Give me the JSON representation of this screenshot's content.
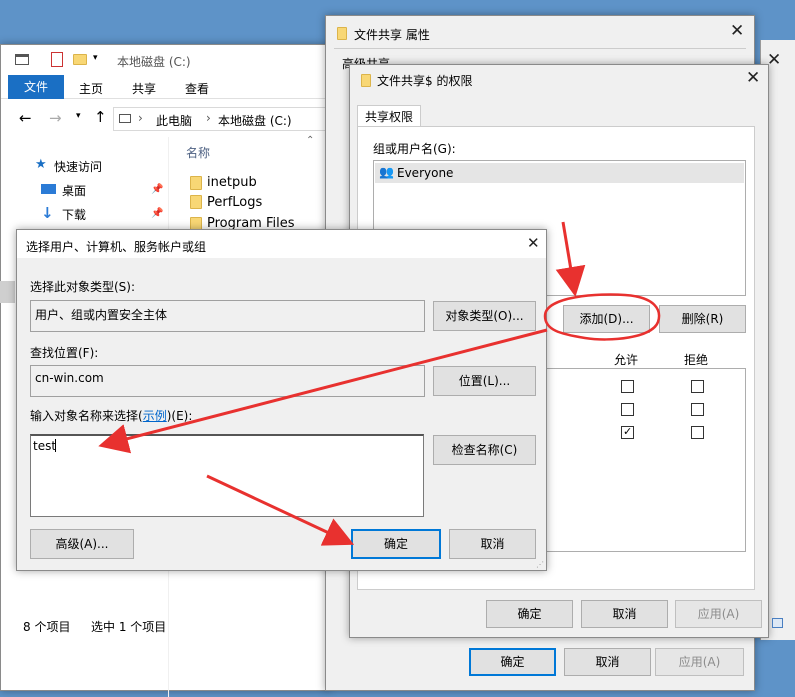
{
  "explorer": {
    "title": "本地磁盘 (C:)",
    "ribbon_tabs": [
      "文件",
      "主页",
      "共享",
      "查看"
    ],
    "breadcrumb": [
      "此电脑",
      "本地磁盘 (C:)"
    ],
    "nav": {
      "quick_access": "快速访问",
      "desktop": "桌面",
      "downloads": "下载"
    },
    "column_name": "名称",
    "files": [
      "inetpub",
      "PerfLogs",
      "Program Files"
    ],
    "status_items": "8 个项目",
    "status_selected": "选中 1 个项目"
  },
  "props": {
    "title": "文件共享 属性",
    "tab_partial": "高级共享",
    "ok": "确定",
    "cancel": "取消",
    "apply": "应用(A)"
  },
  "perms": {
    "title": "文件共享$ 的权限",
    "tab": "共享权限",
    "group_label": "组或用户名(G):",
    "users": [
      "Everyone"
    ],
    "add_button": "添加(D)...",
    "remove_button": "删除(R)",
    "allow_header": "允许",
    "deny_header": "拒绝",
    "rows": [
      {
        "allow": false,
        "deny": false
      },
      {
        "allow": false,
        "deny": false
      },
      {
        "allow": true,
        "deny": false
      }
    ],
    "ok": "确定",
    "cancel": "取消",
    "apply": "应用(A)"
  },
  "select": {
    "title": "选择用户、计算机、服务帐户或组",
    "object_type_label": "选择此对象类型(S):",
    "object_type_value": "用户、组或内置安全主体",
    "object_type_button": "对象类型(O)...",
    "location_label": "查找位置(F):",
    "location_value": "cn-win.com",
    "location_button": "位置(L)...",
    "names_label_prefix": "输入对象名称来选择(",
    "names_label_link": "示例",
    "names_label_suffix": ")(E):",
    "names_value": "test",
    "check_names_button": "检查名称(C)",
    "advanced_button": "高级(A)...",
    "ok": "确定",
    "cancel": "取消"
  },
  "colors": {
    "accent": "#0078d7",
    "annotation": "#e8312f",
    "desktop": "#5e93c8"
  },
  "icons": [
    "folder-icon",
    "close-icon",
    "users-icon",
    "pin-icon",
    "star-icon",
    "download-icon",
    "desktop-icon",
    "checkmark-icon"
  ]
}
